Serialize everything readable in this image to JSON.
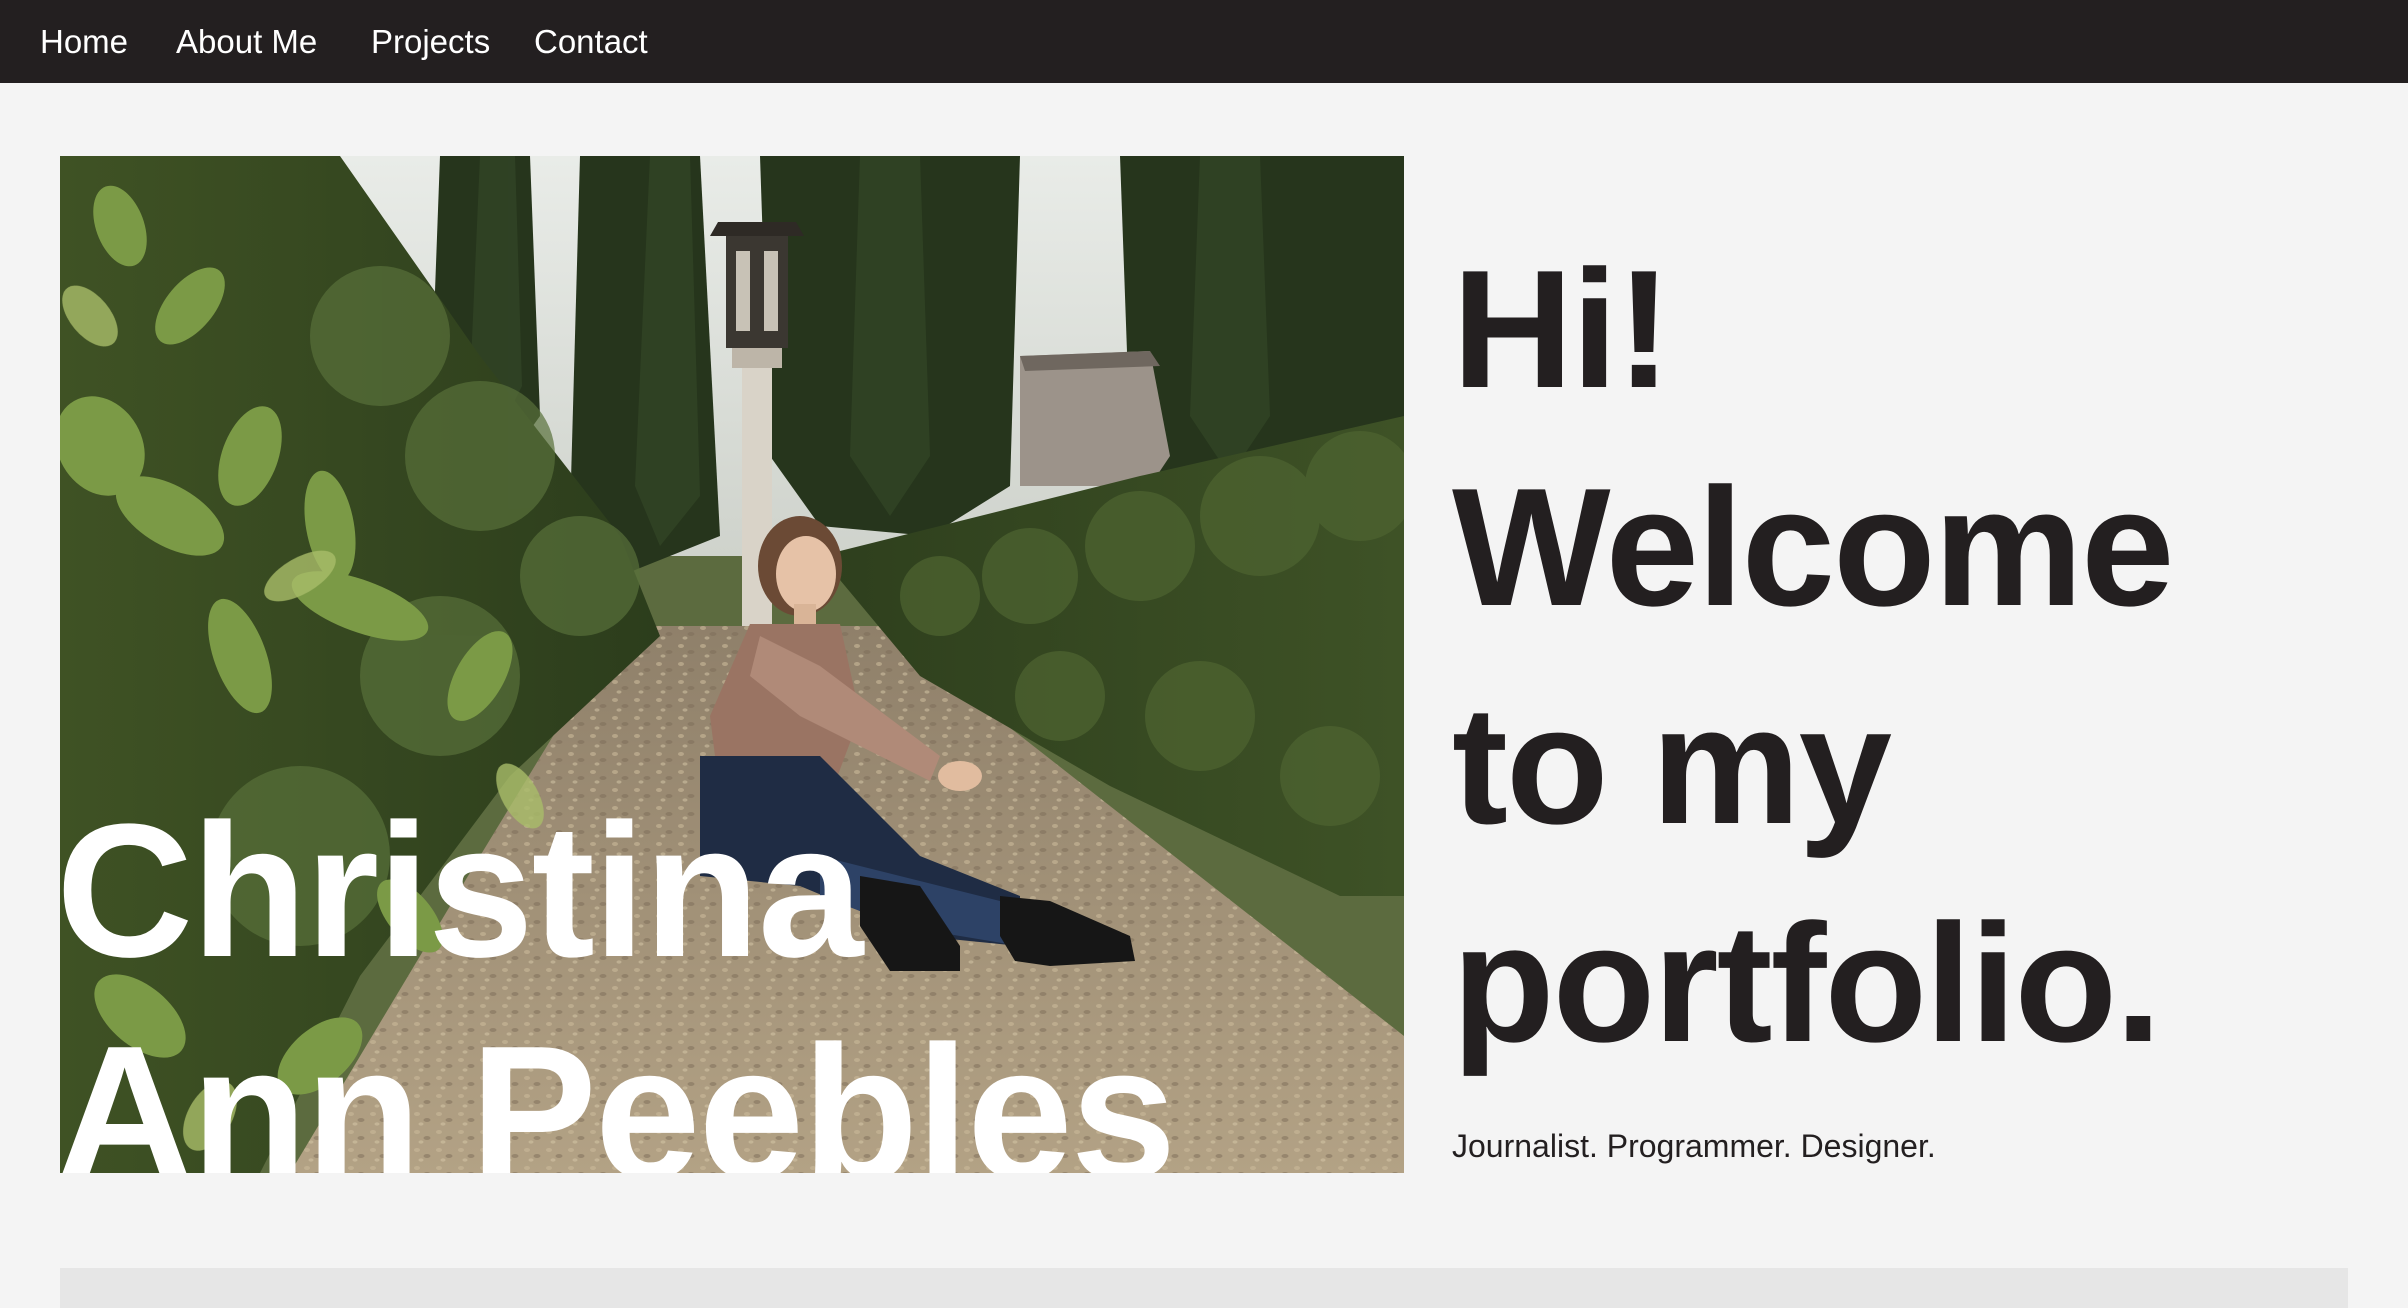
{
  "nav": {
    "items": [
      {
        "label": "Home"
      },
      {
        "label": "About Me"
      },
      {
        "label": "Projects"
      },
      {
        "label": "Contact"
      }
    ]
  },
  "hero": {
    "photo_name_line_1": "Christina",
    "photo_name_line_2": "Ann Peebles",
    "greeting_lines": [
      "Hi!",
      "Welcome",
      "to my",
      "portfolio."
    ],
    "tagline": "Journalist. Programmer. Designer."
  },
  "colors": {
    "navbar_bg": "#231f20",
    "page_bg": "#f4f4f4",
    "text_dark": "#231f20",
    "text_light": "#ffffff",
    "foliage": "#4a5d2c",
    "gravel": "#a8957a"
  }
}
